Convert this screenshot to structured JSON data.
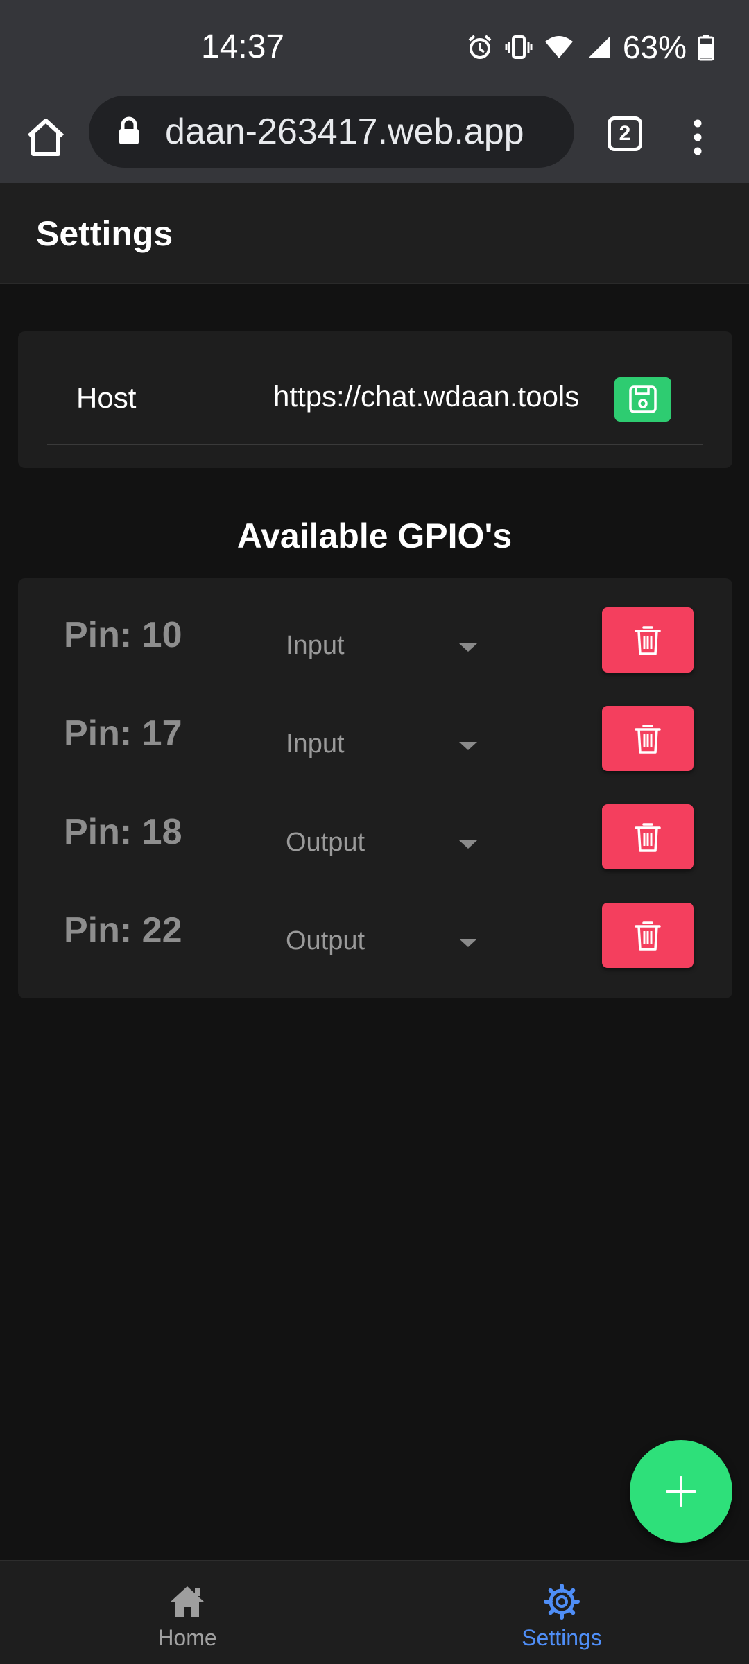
{
  "status_bar": {
    "time": "14:37",
    "icons": [
      "alarm-icon",
      "vibrate-icon",
      "wifi-icon",
      "cell-signal-icon"
    ],
    "battery_percent": "63%"
  },
  "browser": {
    "url": "daan-263417.web.app",
    "tab_count": "2"
  },
  "app_bar": {
    "title": "Settings"
  },
  "host": {
    "label": "Host",
    "value": "https://chat.wdaan.tools"
  },
  "gpio": {
    "section_title": "Available GPIO's",
    "pins": [
      {
        "label": "Pin: 10",
        "mode": "Input"
      },
      {
        "label": "Pin: 17",
        "mode": "Input"
      },
      {
        "label": "Pin: 18",
        "mode": "Output"
      },
      {
        "label": "Pin: 22",
        "mode": "Output"
      }
    ]
  },
  "bottom_nav": {
    "items": [
      {
        "label": "Home",
        "icon": "home-icon",
        "active": false
      },
      {
        "label": "Settings",
        "icon": "gear-icon",
        "active": true
      }
    ]
  },
  "colors": {
    "accent_green": "#2ecc71",
    "fab_green": "#2ee07a",
    "delete_red": "#f43f5e",
    "active_blue": "#4f8ef7",
    "background": "#121212",
    "card": "#1e1e1e"
  }
}
